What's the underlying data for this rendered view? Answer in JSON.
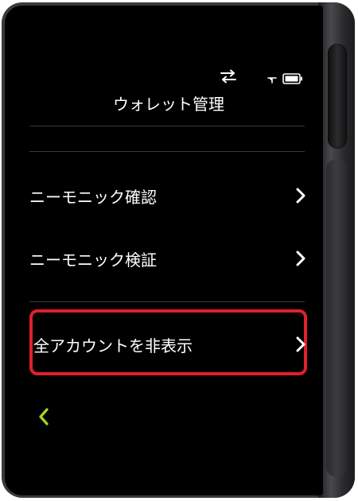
{
  "status_bar": {
    "icons": [
      "transfer-arrows-icon",
      "signal-icon",
      "battery-icon"
    ]
  },
  "header": {
    "title": "ウォレット管理"
  },
  "menu": {
    "items": [
      {
        "label": "ニーモニック確認"
      },
      {
        "label": "ニーモニック検証"
      },
      {
        "label": "全アカウントを非表示"
      }
    ]
  },
  "colors": {
    "screen_bg": "#000000",
    "text": "#ffffff",
    "highlight_border": "#e0202b",
    "back_accent": "#a8d528"
  }
}
